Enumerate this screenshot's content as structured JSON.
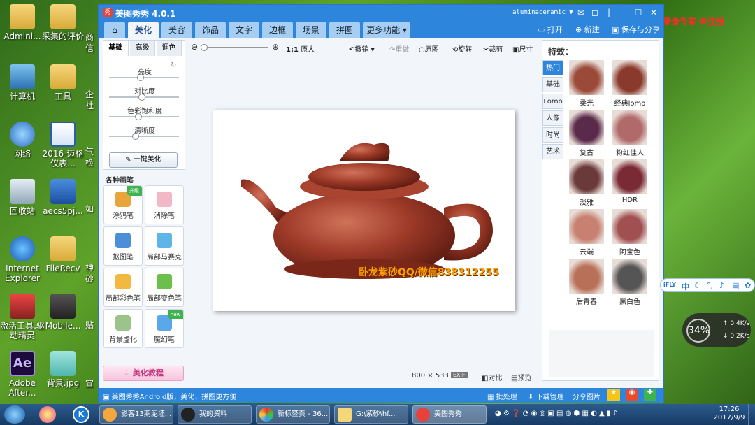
{
  "desktop": {
    "icons": [
      {
        "label": "Admini...",
        "icon": "folder-user-icon"
      },
      {
        "label": "采集的评价",
        "icon": "folder-icon"
      },
      {
        "label": "计算机",
        "icon": "computer-icon"
      },
      {
        "label": "工具",
        "icon": "folder-icon"
      },
      {
        "label": "网络",
        "icon": "network-icon"
      },
      {
        "label": "2016-迈格仪表...",
        "icon": "word-doc-icon"
      },
      {
        "label": "回收站",
        "icon": "recycle-bin-icon"
      },
      {
        "label": "aecs5pj...",
        "icon": "archive-icon"
      },
      {
        "label": "Internet Explorer",
        "icon": "ie-icon"
      },
      {
        "label": "FileRecv",
        "icon": "folder-icon"
      },
      {
        "label": "激活工具.驱动精灵",
        "icon": "app-icon"
      },
      {
        "label": "Mobile...",
        "icon": "media-icon"
      },
      {
        "label": "Adobe After...",
        "icon": "after-effects-icon"
      },
      {
        "label": "背景.jpg",
        "icon": "image-file-icon"
      }
    ],
    "clipped": [
      "商",
      "信",
      "企",
      "社",
      "气",
      "检",
      "如",
      "神",
      "砂",
      "贴",
      "宣"
    ]
  },
  "window": {
    "app_title": "美图秀秀 4.0.1",
    "app_logo": "秀",
    "user": "aluminaceramic ▼",
    "tabs": [
      "美化",
      "美容",
      "饰品",
      "文字",
      "边框",
      "场景",
      "拼图",
      "更多功能 ▾"
    ],
    "active_tab": "美化",
    "actions": {
      "open": "打开",
      "new": "新建",
      "save": "保存与分享"
    },
    "recorder_overlay": "屏幕录像专家 未注册",
    "toolbar": {
      "zoom_label": "1:1",
      "original": "原大",
      "undo": "撤销",
      "redo": "重做",
      "origin": "原图",
      "rotate": "旋转",
      "crop": "裁剪",
      "size": "尺寸"
    },
    "left_panel": {
      "subtabs": [
        "基础",
        "高级",
        "调色"
      ],
      "adjust": [
        {
          "label": "亮度",
          "level": 0.45
        },
        {
          "label": "对比度",
          "level": 0.47
        },
        {
          "label": "色彩饱和度",
          "level": 0.42
        },
        {
          "label": "清晰度",
          "level": 0.38
        }
      ],
      "one_key": "一键美化",
      "brush_title": "各种画笔",
      "brushes": [
        {
          "label": "涂鸦笔",
          "badge": "升级"
        },
        {
          "label": "消除笔",
          "badge": ""
        },
        {
          "label": "抠图笔",
          "badge": ""
        },
        {
          "label": "局部马赛克",
          "badge": ""
        },
        {
          "label": "局部彩色笔",
          "badge": ""
        },
        {
          "label": "局部变色笔",
          "badge": ""
        },
        {
          "label": "背景虚化",
          "badge": ""
        },
        {
          "label": "魔幻笔",
          "badge": "new"
        }
      ],
      "tutorial": "美化教程"
    },
    "canvas": {
      "watermark": "卧龙紫砂QQ/微信838312255"
    },
    "image_info": {
      "size": "800 × 533",
      "exif": "EXIF",
      "compare": "对比",
      "preview": "预览"
    },
    "effects": {
      "title": "特效：",
      "tabs": [
        "热门",
        "基础",
        "Lomo",
        "人像",
        "时尚",
        "艺术"
      ],
      "items": [
        {
          "label": "柔光",
          "color": "#9b4a3a"
        },
        {
          "label": "经典lomo",
          "color": "#8a3a2c"
        },
        {
          "label": "复古",
          "color": "#5a2a4a"
        },
        {
          "label": "粉红佳人",
          "color": "#b06a6a"
        },
        {
          "label": "淡雅",
          "color": "#6a3a3a"
        },
        {
          "label": "HDR",
          "color": "#7a2a34"
        },
        {
          "label": "云端",
          "color": "#c88070"
        },
        {
          "label": "阿宝色",
          "color": "#a05050"
        },
        {
          "label": "后青春",
          "color": "#b87058"
        },
        {
          "label": "黑白色",
          "color": "#555555"
        }
      ]
    },
    "status": {
      "promo": "美图秀秀Android版，美化、拼图更方便",
      "batch": "批处理",
      "download": "下载管理",
      "share": "分享图片"
    }
  },
  "ime_bar": {
    "brand": "iFLY",
    "items": [
      "中",
      "☾",
      "°,",
      "♪",
      "▤",
      "✿"
    ]
  },
  "net_widget": {
    "percent": "34%",
    "up": "0.4K/s",
    "down": "0.2K/s"
  },
  "taskbar": {
    "tasks": [
      "影客13期泥坯...",
      "我的资料",
      "新标签页 - 36...",
      "G:\\紫砂\\hf...",
      "美图秀秀"
    ],
    "time": "17:26",
    "date": "2017/9/9"
  }
}
